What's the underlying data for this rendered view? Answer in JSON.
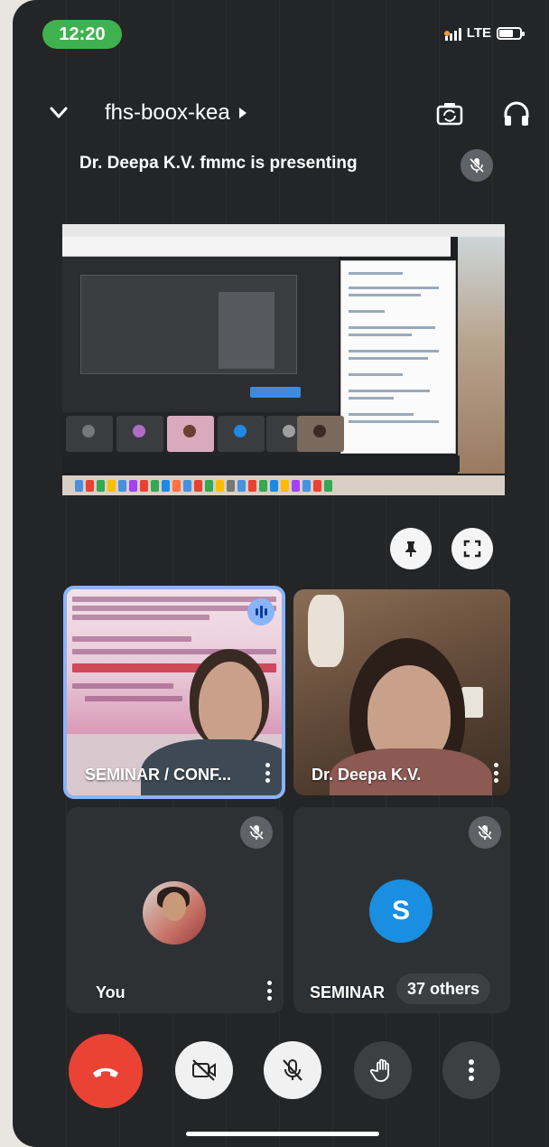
{
  "status_bar": {
    "time": "12:20",
    "network": "LTE",
    "battery_level": 0.7
  },
  "header": {
    "meeting_code": "fhs-boox-kea",
    "icons": [
      "chevron-down-icon",
      "chevron-right-icon",
      "switch-camera-icon",
      "headphones-icon"
    ]
  },
  "presenting": {
    "text": "Dr. Deepa K.V. fmmc is presenting"
  },
  "tiles": [
    {
      "label": "SEMINAR / CONF...",
      "speaking": true
    },
    {
      "label": "Dr. Deepa K.V."
    },
    {
      "label": "You",
      "muted": true
    },
    {
      "label": "SEMINAR",
      "avatar_letter": "S",
      "others": "37 others",
      "muted": true
    }
  ],
  "controls": {
    "icons": [
      "end-call-icon",
      "camera-off-icon",
      "mic-off-icon",
      "raise-hand-icon",
      "more-vert-icon"
    ]
  },
  "colors": {
    "time_pill": "#3fb24f",
    "end_call": "#ea4335",
    "speaking_border": "#8ab4f8",
    "avatar_s": "#1a8ee0"
  }
}
